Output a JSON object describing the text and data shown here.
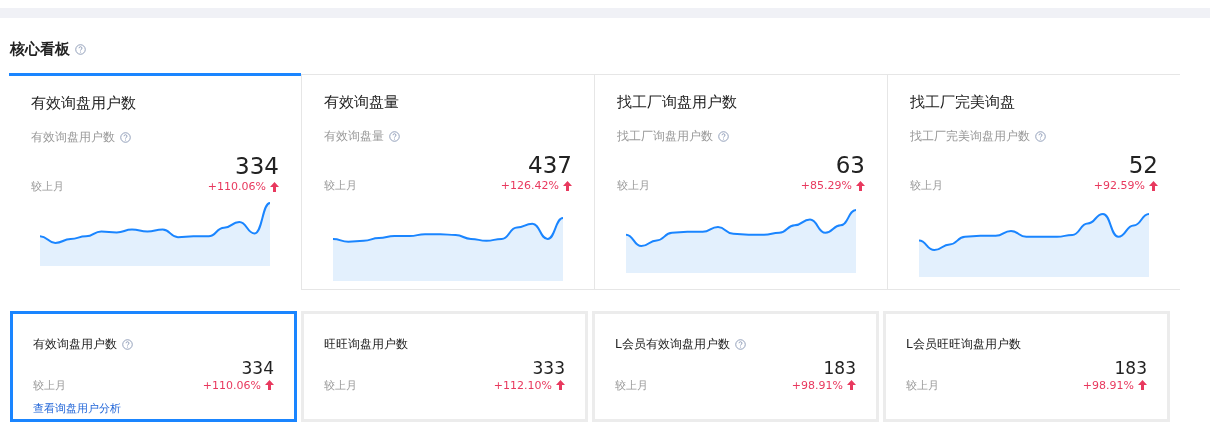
{
  "section": {
    "title": "核心看板",
    "help": true
  },
  "top_cards": [
    {
      "title": "有效询盘用户数",
      "subtitle": "有效询盘用户数",
      "help": true,
      "value": "334",
      "compare_label": "较上月",
      "change": "+110.06%",
      "selected": true
    },
    {
      "title": "有效询盘量",
      "subtitle": "有效询盘量",
      "help": true,
      "value": "437",
      "compare_label": "较上月",
      "change": "+126.42%",
      "selected": false
    },
    {
      "title": "找工厂询盘用户数",
      "subtitle": "找工厂询盘用户数",
      "help": true,
      "value": "63",
      "compare_label": "较上月",
      "change": "+85.29%",
      "selected": false
    },
    {
      "title": "找工厂完美询盘",
      "subtitle": "找工厂完美询盘用户数",
      "help": true,
      "value": "52",
      "compare_label": "较上月",
      "change": "+92.59%",
      "selected": false
    }
  ],
  "sub_cards": [
    {
      "title": "有效询盘用户数",
      "help": true,
      "value": "334",
      "compare_label": "较上月",
      "change": "+110.06%",
      "link": "查看询盘用户分析",
      "selected": true
    },
    {
      "title": "旺旺询盘用户数",
      "help": false,
      "value": "333",
      "compare_label": "较上月",
      "change": "+112.10%",
      "selected": false
    },
    {
      "title": "L会员有效询盘用户数",
      "help": true,
      "value": "183",
      "compare_label": "较上月",
      "change": "+98.91%",
      "selected": false
    },
    {
      "title": "L会员旺旺询盘用户数",
      "help": false,
      "value": "183",
      "compare_label": "较上月",
      "change": "+98.91%",
      "selected": false
    }
  ]
}
